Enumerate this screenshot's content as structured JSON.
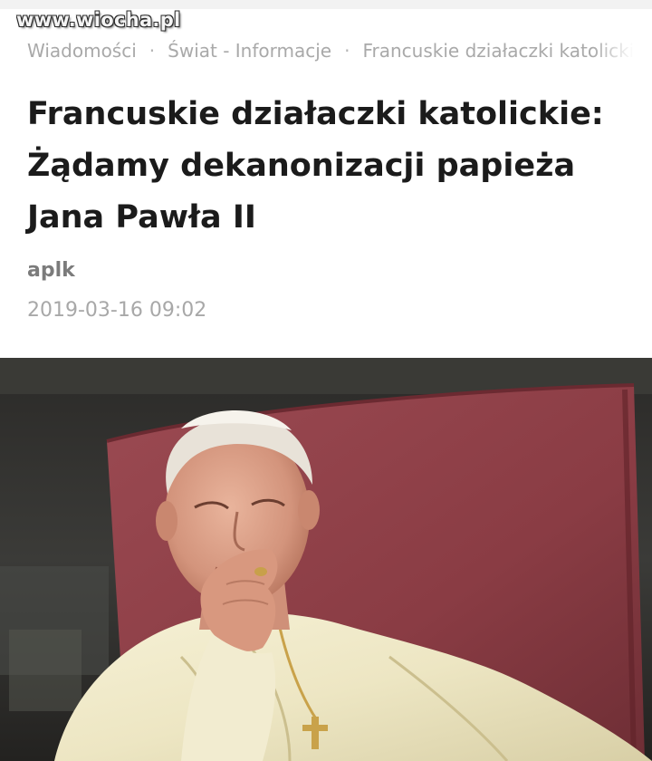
{
  "watermark": "www.wiocha.pl",
  "breadcrumb": {
    "items": [
      "Wiadomości",
      "Świat - Informacje",
      "Francuskie działaczki katolickie"
    ],
    "separator": "·"
  },
  "article": {
    "title_lines": [
      "Francuskie działaczki katolickie:",
      "Żądamy dekanonizacji papieża",
      "Jana Pawła II"
    ],
    "author": "aplk",
    "date": "2019-03-16 09:02"
  },
  "colors": {
    "title": "#1b1b1b",
    "author": "#7b7b7b",
    "meta": "#a8a8a8",
    "chair": "#8e3f48"
  },
  "photo": {
    "icon": "photo-of-pope-in-red-chair"
  }
}
